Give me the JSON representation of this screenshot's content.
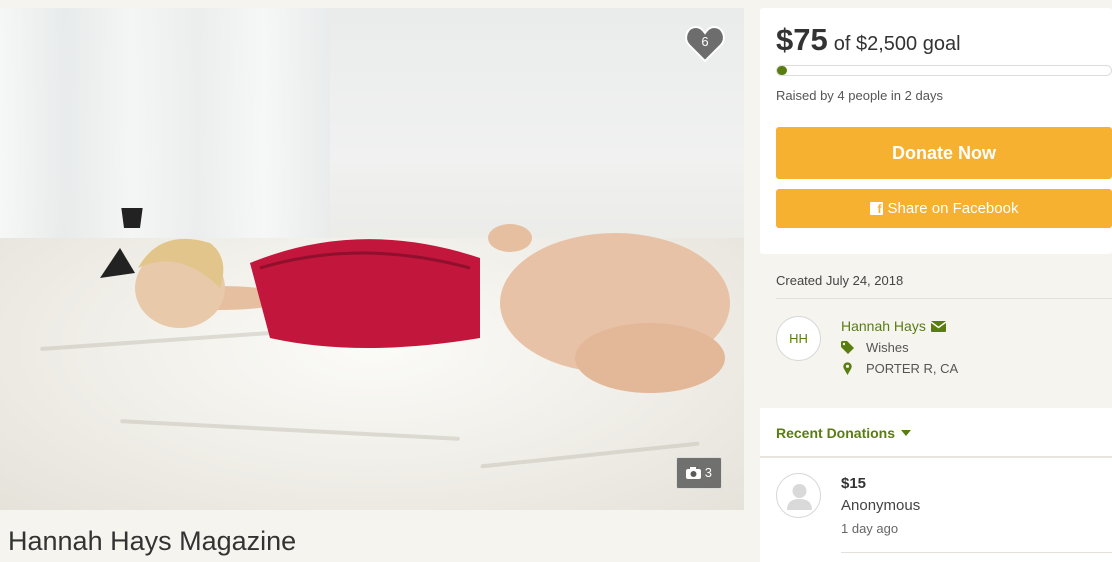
{
  "campaign": {
    "title": "Hannah Hays Magazine",
    "hearts": "6",
    "photo_count": "3"
  },
  "funding": {
    "raised": "$75",
    "goal_text": "of $2,500 goal",
    "progress_fraction": 0.03,
    "raised_by": "Raised by 4 people in 2 days",
    "donate_label": "Donate Now",
    "share_label": "Share on Facebook"
  },
  "info": {
    "created": "Created July 24, 2018",
    "organizer_initials": "HH",
    "organizer_name": "Hannah Hays",
    "category": "Wishes",
    "location": "PORTER R, CA"
  },
  "recent": {
    "header": "Recent Donations",
    "donations": [
      {
        "amount": "$15",
        "name": "Anonymous",
        "time": "1 day ago"
      }
    ]
  },
  "colors": {
    "accent_green": "#5a7d12",
    "button_orange": "#f5b12f"
  }
}
